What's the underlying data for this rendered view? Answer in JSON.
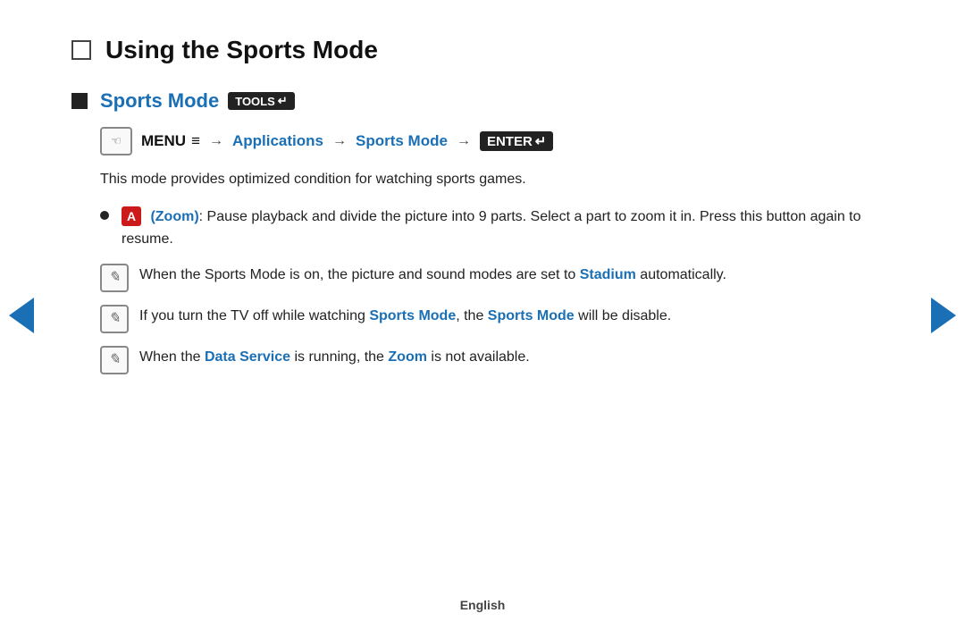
{
  "page": {
    "title": "Using the Sports Mode",
    "section": {
      "title": "Sports Mode",
      "tools_label": "TOOLS",
      "tools_symbol": "↵"
    },
    "menu_path": {
      "icon_symbol": "☜",
      "menu_label": "MENU",
      "menu_bars": "≡",
      "arrow": "→",
      "step1": "Applications",
      "step2": "Sports Mode",
      "enter_label": "ENTER",
      "enter_symbol": "↵"
    },
    "description": "This mode provides optimized condition for watching sports games.",
    "bullet": {
      "zoom_letter": "A",
      "zoom_label": "Zoom",
      "text": ": Pause playback and divide the picture into 9 parts. Select a part to zoom it in. Press this button again to resume."
    },
    "notes": [
      {
        "id": "note1",
        "text_parts": [
          {
            "type": "plain",
            "text": "When the Sports Mode is on, the picture and sound modes are set to "
          },
          {
            "type": "link",
            "text": "Stadium"
          },
          {
            "type": "plain",
            "text": " automatically."
          }
        ]
      },
      {
        "id": "note2",
        "text_parts": [
          {
            "type": "plain",
            "text": "If you turn the TV off while watching "
          },
          {
            "type": "link",
            "text": "Sports Mode"
          },
          {
            "type": "plain",
            "text": ", the "
          },
          {
            "type": "link",
            "text": "Sports Mode"
          },
          {
            "type": "plain",
            "text": " will be disable."
          }
        ]
      },
      {
        "id": "note3",
        "text_parts": [
          {
            "type": "plain",
            "text": "When the "
          },
          {
            "type": "link",
            "text": "Data Service"
          },
          {
            "type": "plain",
            "text": " is running, the "
          },
          {
            "type": "link",
            "text": "Zoom"
          },
          {
            "type": "plain",
            "text": " is not available."
          }
        ]
      }
    ],
    "footer": "English"
  }
}
